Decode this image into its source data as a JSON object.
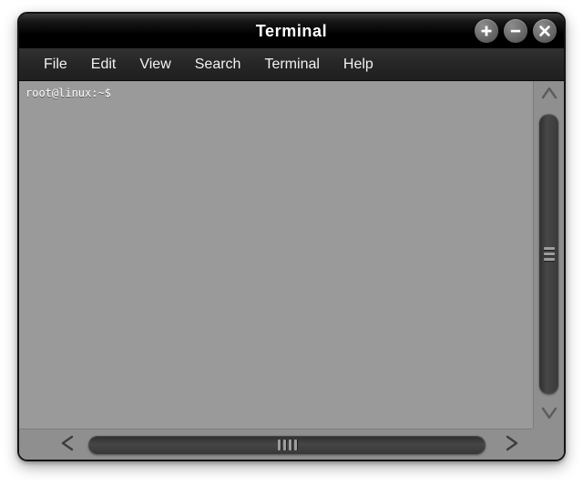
{
  "window": {
    "title": "Terminal",
    "controls": [
      {
        "name": "maximize-button",
        "icon": "plus-icon",
        "label": "+"
      },
      {
        "name": "minimize-button",
        "icon": "minus-icon",
        "label": "−"
      },
      {
        "name": "close-button",
        "icon": "close-icon",
        "label": "×"
      }
    ]
  },
  "menubar": {
    "items": [
      {
        "label": "File"
      },
      {
        "label": "Edit"
      },
      {
        "label": "View"
      },
      {
        "label": "Search"
      },
      {
        "label": "Terminal"
      },
      {
        "label": "Help"
      }
    ]
  },
  "terminal": {
    "lines": [
      "root@linux:~$"
    ],
    "prompt": "root@linux:~$",
    "background_color": "#9a9a9a",
    "text_color": "#ffffff"
  },
  "scrollbars": {
    "vertical": {
      "up_arrow_icon": "chevron-up-icon",
      "down_arrow_icon": "chevron-down-icon",
      "grip_count": 3
    },
    "horizontal": {
      "left_arrow_icon": "chevron-left-icon",
      "right_arrow_icon": "chevron-right-icon",
      "grip_count": 4
    }
  },
  "colors": {
    "titlebar": "#000000",
    "menubar": "#262626",
    "window_border": "#141414",
    "scrollbar_trough": "#8f8f8f",
    "scrollbar_thumb": "#3a3a3a",
    "page_background": "#ffffff"
  }
}
